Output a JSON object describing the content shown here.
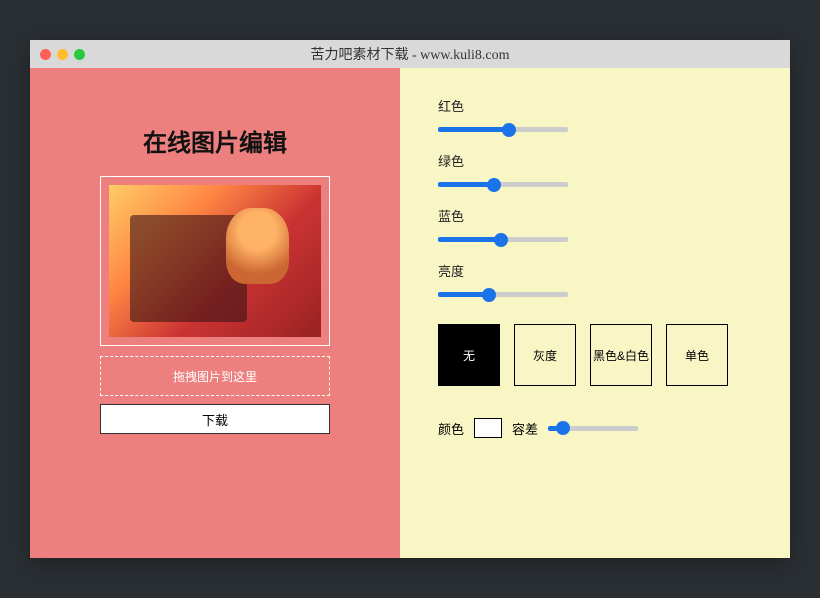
{
  "titlebar": {
    "title": "苦力吧素材下载 - www.kuli8.com"
  },
  "left": {
    "heading": "在线图片编辑",
    "dropzone_text": "拖拽图片到这里",
    "download_label": "下载"
  },
  "sliders": {
    "red": {
      "label": "红色",
      "value": 55
    },
    "green": {
      "label": "绿色",
      "value": 42
    },
    "blue": {
      "label": "蓝色",
      "value": 48
    },
    "brightness": {
      "label": "亮度",
      "value": 38
    }
  },
  "filters": {
    "none": "无",
    "grayscale": "灰度",
    "bw": "黑色&白色",
    "mono": "单色",
    "active": "none"
  },
  "bottom": {
    "color_label": "颜色",
    "tolerance_label": "容差",
    "tolerance_value": 10
  }
}
